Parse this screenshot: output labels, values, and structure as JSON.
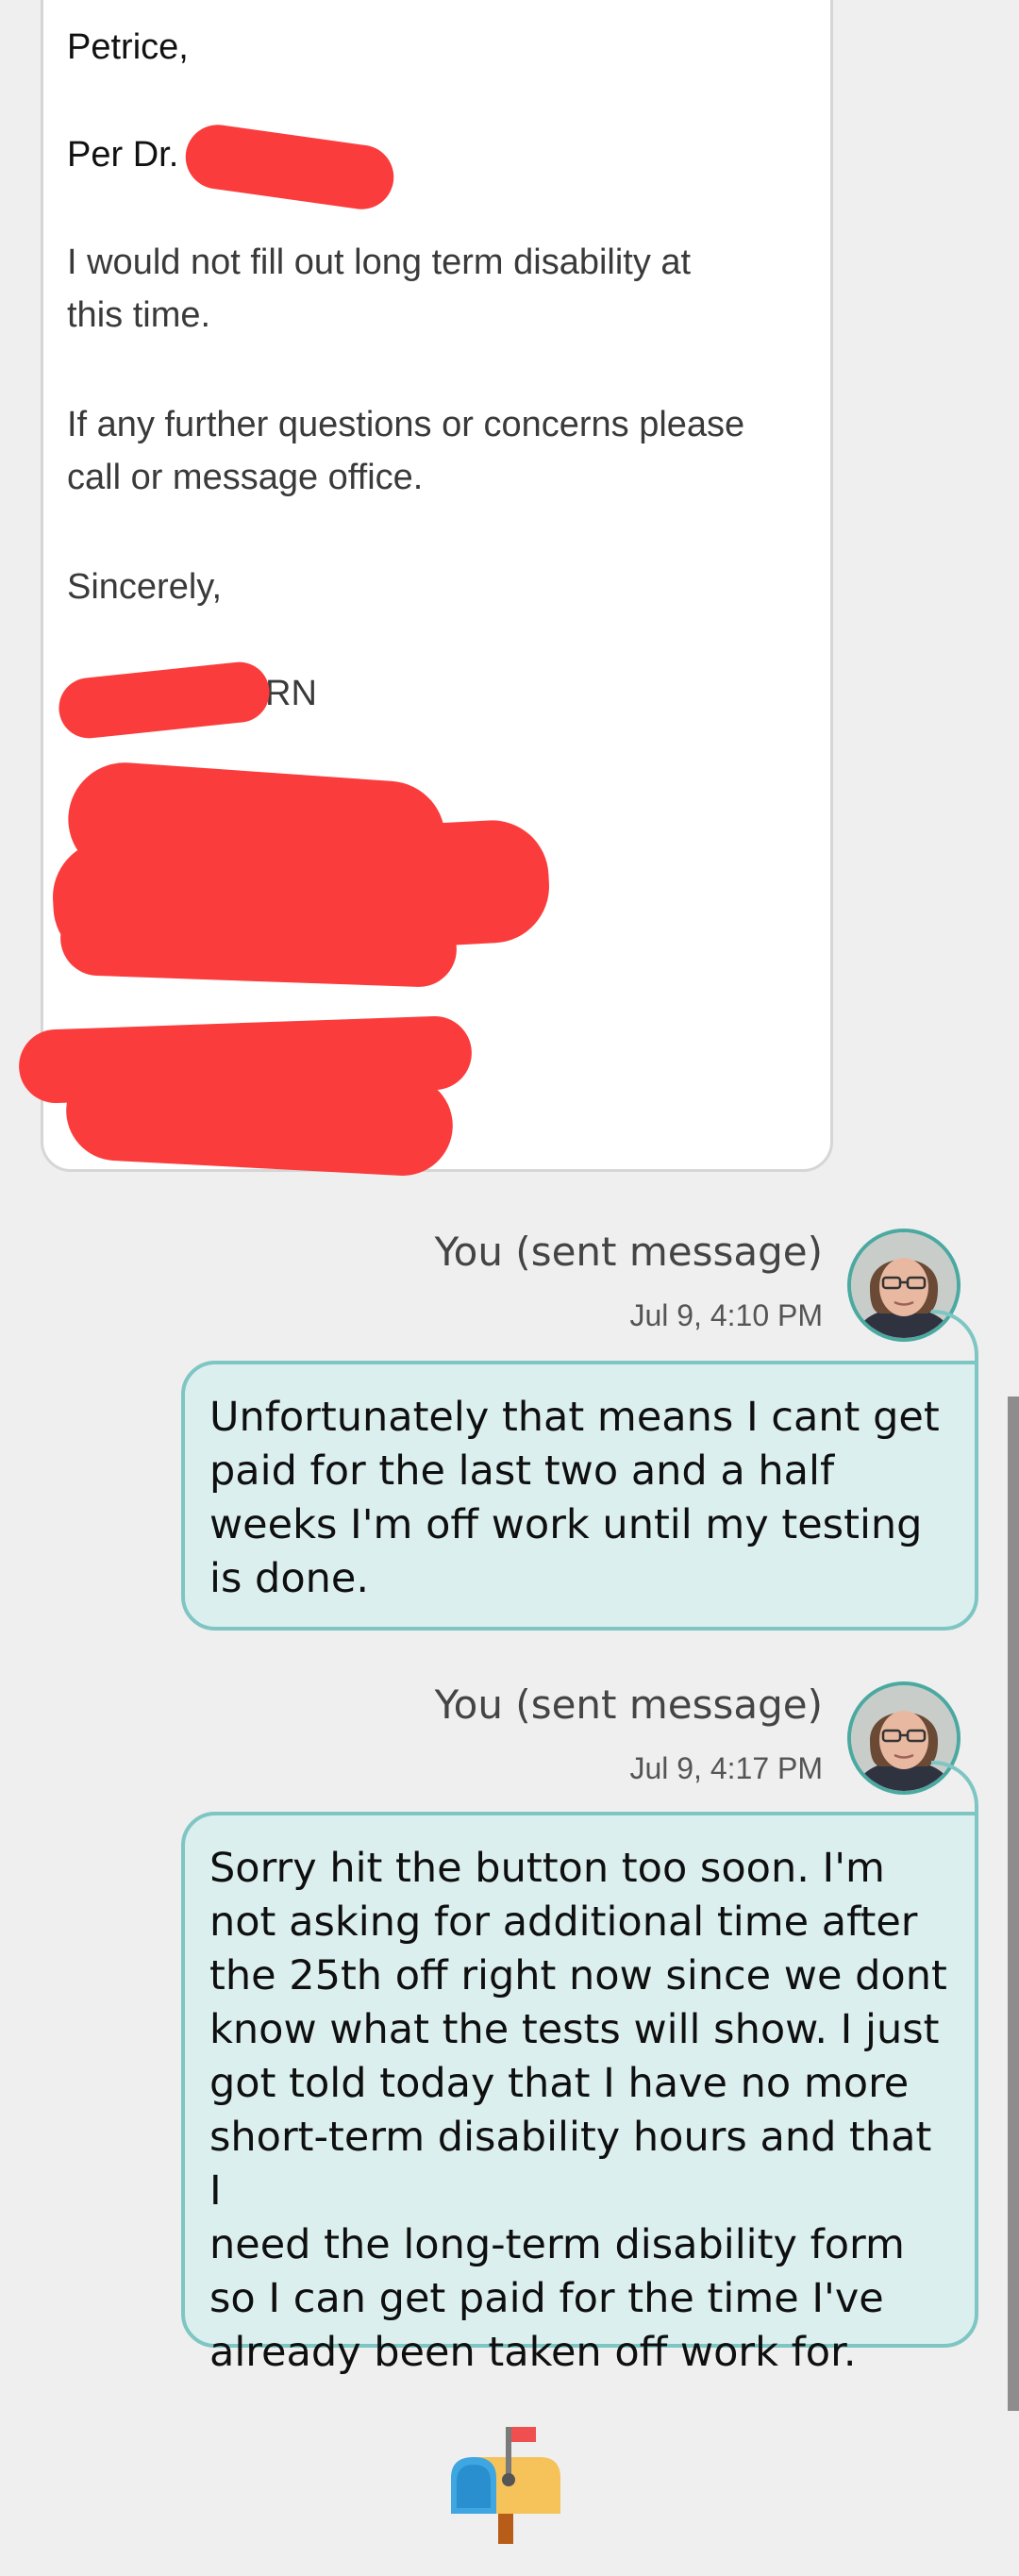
{
  "received": {
    "greeting": "Petrice,",
    "per_line": "Per Dr.",
    "body1_line1": "I would not fill out long term disability at",
    "body1_line2": "this time.",
    "body2_line1": "If any further questions or concerns please",
    "body2_line2": "call or message office.",
    "closing": "Sincerely,",
    "signature_suffix": "RN"
  },
  "messages": [
    {
      "sender": "You (sent message)",
      "time": "Jul 9, 4:10 PM",
      "lines": [
        "Unfortunately that means I cant get",
        "paid for the last two and a half",
        "weeks I'm off work until my testing",
        "is done."
      ]
    },
    {
      "sender": "You (sent message)",
      "time": "Jul 9, 4:17 PM",
      "lines": [
        "Sorry hit the button too soon. I'm",
        "not asking for additional time after",
        "the 25th off right now since we dont",
        "know what the tests will show. I just",
        "got told today that I have no more",
        "short-term disability hours and that I",
        "need the long-term disability form",
        "so I can get paid for the time I've",
        "already been taken off work for."
      ]
    }
  ],
  "icons": {
    "avatar": "user-avatar",
    "mailbox": "mailbox-icon"
  },
  "colors": {
    "background": "#efefef",
    "sent_bubble_bg": "#dcefef",
    "sent_bubble_border": "#7ec6c3",
    "redaction": "#fb3c3c"
  }
}
